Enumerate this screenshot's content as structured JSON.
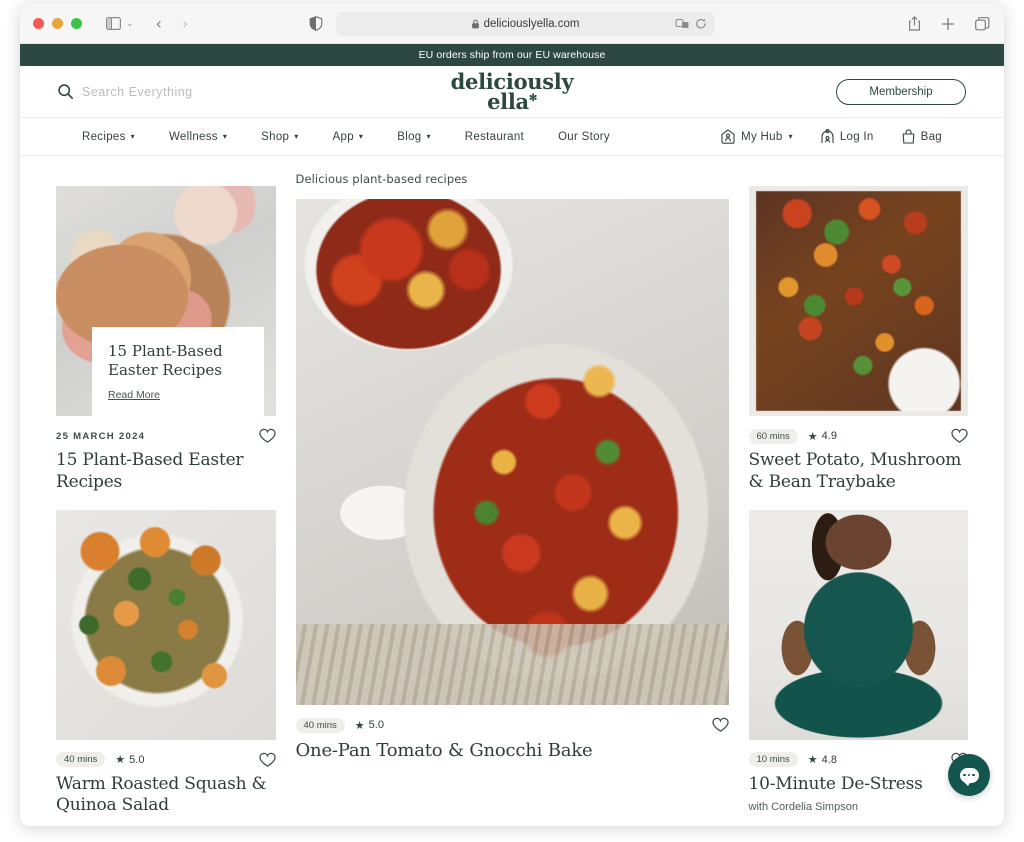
{
  "browser": {
    "url": "deliciouslyella.com",
    "icons": {
      "sidebar": "sidebar-toggle-icon",
      "back": "back-arrow-icon",
      "forward": "forward-arrow-icon",
      "shield": "privacy-shield-icon",
      "lock": "lock-icon",
      "extension": "extension-icon",
      "reload": "reload-icon",
      "share": "share-icon",
      "newtab": "plus-icon",
      "tabs": "tab-overview-icon"
    }
  },
  "announcement": {
    "text": "EU orders ship from our EU warehouse"
  },
  "header": {
    "search_placeholder": "Search Everything",
    "logo_line1": "deliciously",
    "logo_line2": "ella",
    "logo_mark": "✻",
    "membership_label": "Membership"
  },
  "nav": {
    "primary": [
      {
        "label": "Recipes",
        "has_dropdown": true
      },
      {
        "label": "Wellness",
        "has_dropdown": true
      },
      {
        "label": "Shop",
        "has_dropdown": true
      },
      {
        "label": "App",
        "has_dropdown": true
      },
      {
        "label": "Blog",
        "has_dropdown": true
      },
      {
        "label": "Restaurant",
        "has_dropdown": false
      },
      {
        "label": "Our Story",
        "has_dropdown": false
      }
    ],
    "utility": [
      {
        "label": "My Hub",
        "icon": "hub-house-icon",
        "has_dropdown": true
      },
      {
        "label": "Log In",
        "icon": "account-icon",
        "has_dropdown": false
      },
      {
        "label": "Bag",
        "icon": "bag-icon",
        "has_dropdown": false
      }
    ]
  },
  "main": {
    "section_label": "Delicious plant-based recipes",
    "hero": {
      "overlay_title": "15 Plant-Based Easter Recipes",
      "read_more": "Read More",
      "date": "25 MARCH 2024",
      "title": "15 Plant-Based Easter Recipes",
      "image": "rhubarb-crumble-bowls"
    },
    "cards": [
      {
        "id": "warm-roasted-squash-quinoa-salad",
        "time": "40 mins",
        "rating": "5.0",
        "title": "Warm Roasted Squash & Quinoa Salad",
        "image": "quinoa-salad-plate"
      },
      {
        "id": "one-pan-tomato-gnocchi-bake",
        "time": "40 mins",
        "rating": "5.0",
        "title": "One-Pan Tomato & Gnocchi Bake",
        "image": "tomato-gnocchi-pan"
      },
      {
        "id": "sweet-potato-mushroom-bean-traybake",
        "time": "60 mins",
        "rating": "4.9",
        "title": "Sweet Potato, Mushroom & Bean Traybake",
        "image": "traybake-sheet-pan"
      },
      {
        "id": "10-minute-de-stress",
        "time": "10 mins",
        "rating": "4.8",
        "title": "10-Minute De-Stress",
        "subtitle": "with Cordelia Simpson",
        "image": "yoga-seated-woman"
      }
    ]
  },
  "chat": {
    "icon": "chat-bubble-icon"
  },
  "colors": {
    "brand_green": "#2c4840",
    "chat_green": "#14554d",
    "pill_bg": "#efeeea",
    "text_dark": "#2f3d37"
  }
}
